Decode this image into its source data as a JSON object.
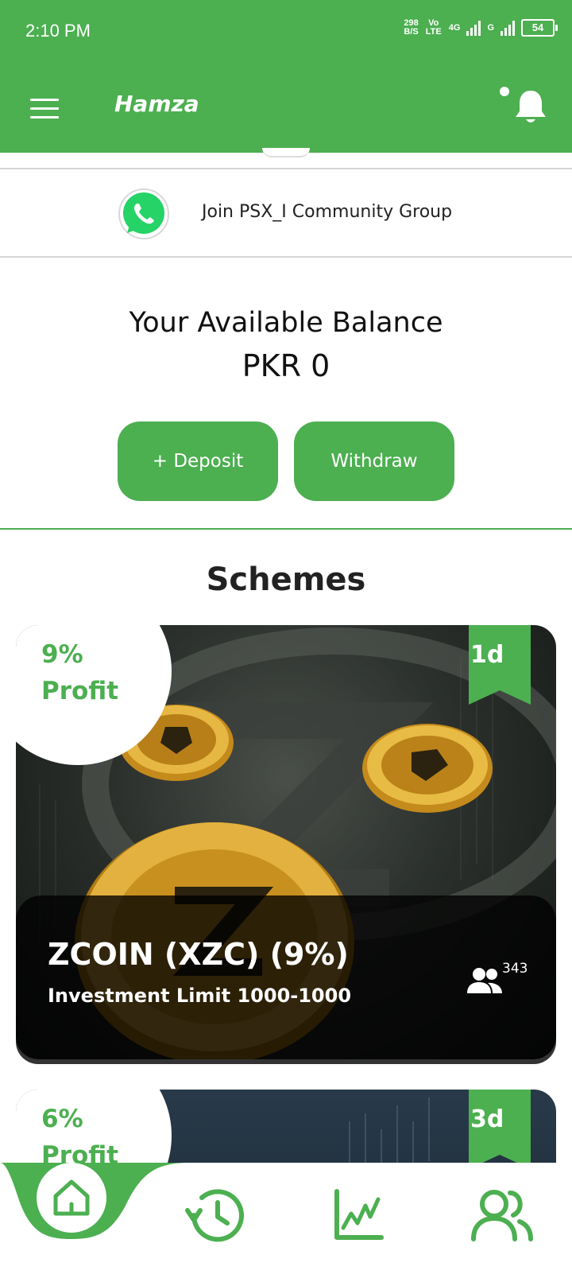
{
  "status_bar": {
    "time": "2:10 PM",
    "net_speed_value": "298",
    "net_speed_unit": "B/S",
    "volte": "Vo LTE",
    "network_4g": "4G",
    "network_g": "G",
    "battery": "54"
  },
  "header": {
    "title": "Hamza",
    "menu_icon": "hamburger-menu-icon",
    "notification_icon": "bell-icon"
  },
  "community": {
    "icon": "whatsapp-icon",
    "label": "Join PSX_I Community Group"
  },
  "balance": {
    "title": "Your Available Balance",
    "value": "PKR 0"
  },
  "actions": {
    "deposit_label": "+ Deposit",
    "withdraw_label": "Withdraw"
  },
  "schemes": {
    "title": "Schemes",
    "items": [
      {
        "profit": "9% Profit",
        "duration": "1d",
        "name": "ZCOIN (XZC) (9%)",
        "limit": "Investment Limit 1000-1000",
        "members": "343"
      },
      {
        "profit": "6% Profit",
        "duration": "3d"
      }
    ]
  },
  "bottom_nav": {
    "items": [
      "home-icon",
      "history-icon",
      "chart-icon",
      "team-icon"
    ],
    "active": "home-icon"
  },
  "colors": {
    "primary": "#4caf50",
    "text_dark": "#1a1a1a",
    "card_dark": "#2b302c"
  }
}
